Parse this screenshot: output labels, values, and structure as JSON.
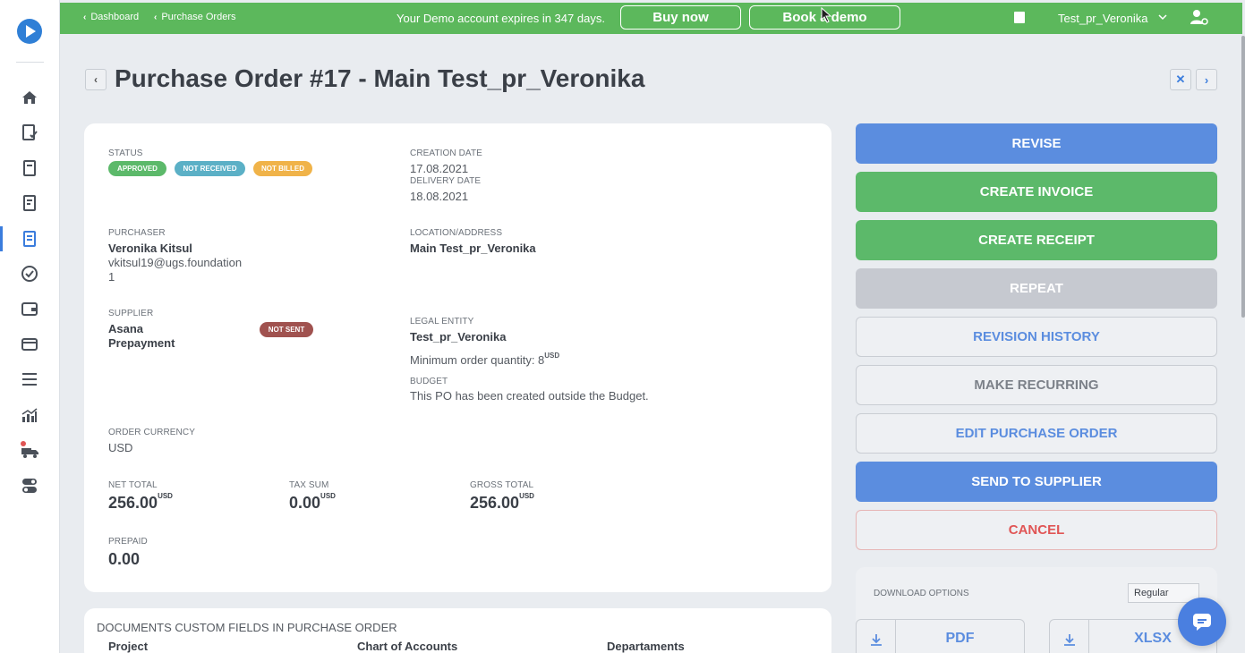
{
  "topbar": {
    "breadcrumbs": [
      "Dashboard",
      "Purchase Orders"
    ],
    "demo_text": "Your Demo account expires in 347 days.",
    "buy_label": "Buy now",
    "book_label": "Book a demo",
    "user_name": "Test_pr_Veronika",
    "color": "#5cb85c"
  },
  "page": {
    "title": "Purchase Order #17 - Main Test_pr_Veronika"
  },
  "details": {
    "status_label": "STATUS",
    "status_badges": [
      {
        "text": "APPROVED",
        "color": "#5cb96a"
      },
      {
        "text": "NOT RECEIVED",
        "color": "#5bb0c6"
      },
      {
        "text": "NOT BILLED",
        "color": "#f0b349"
      }
    ],
    "creation_label": "CREATION DATE",
    "creation_value": "17.08.2021",
    "delivery_label": "DELIVERY DATE",
    "delivery_value": "18.08.2021",
    "purchaser_label": "PURCHASER",
    "purchaser_name": "Veronika Kitsul",
    "purchaser_email_line1": "vkitsul19@ugs.foundation",
    "purchaser_email_line2": "1",
    "location_label": "LOCATION/ADDRESS",
    "location_value": "Main Test_pr_Veronika",
    "supplier_label": "SUPPLIER",
    "supplier_line1": "Asana",
    "supplier_line2": "Prepayment",
    "supplier_badge": {
      "text": "NOT SENT",
      "color": "#a0524f"
    },
    "legal_label": "LEGAL ENTITY",
    "legal_value": "Test_pr_Veronika",
    "min_order_text": "Minimum order quantity: 8",
    "min_order_unit": "USD",
    "budget_label": "BUDGET",
    "budget_value": "This PO has been created outside the Budget.",
    "currency_label": "ORDER CURRENCY",
    "currency_value": "USD",
    "net_label": "NET TOTAL",
    "net_value": "256.00",
    "tax_label": "TAX SUM",
    "tax_value": "0.00",
    "gross_label": "GROSS TOTAL",
    "gross_value": "256.00",
    "unit": "USD",
    "prepaid_label": "PREPAID",
    "prepaid_value": "0.00"
  },
  "custom_fields": {
    "title": "DOCUMENTS CUSTOM FIELDS IN PURCHASE ORDER",
    "columns": [
      "Project",
      "Chart of Accounts",
      "Departaments"
    ]
  },
  "actions": [
    {
      "label": "REVISE",
      "style": "blue"
    },
    {
      "label": "CREATE INVOICE",
      "style": "green"
    },
    {
      "label": "CREATE RECEIPT",
      "style": "green"
    },
    {
      "label": "REPEAT",
      "style": "gray"
    },
    {
      "label": "REVISION HISTORY",
      "style": "outline"
    },
    {
      "label": "MAKE RECURRING",
      "style": "outline-dark"
    },
    {
      "label": "EDIT PURCHASE ORDER",
      "style": "outline"
    },
    {
      "label": "SEND TO SUPPLIER",
      "style": "blue"
    },
    {
      "label": "CANCEL",
      "style": "outline-red"
    }
  ],
  "download": {
    "label": "DOWNLOAD OPTIONS",
    "selected": "Regular",
    "pdf_label": "PDF",
    "xlsx_label": "XLSX"
  },
  "icons": {
    "sidebar": [
      "home-icon",
      "checklist-icon",
      "document-icon",
      "document-alt-icon",
      "purchase-order-icon",
      "check-circle-icon",
      "wallet-icon",
      "card-icon",
      "menu-lines-icon",
      "analytics-icon",
      "delivery-truck-icon",
      "toggle-settings-icon"
    ]
  }
}
